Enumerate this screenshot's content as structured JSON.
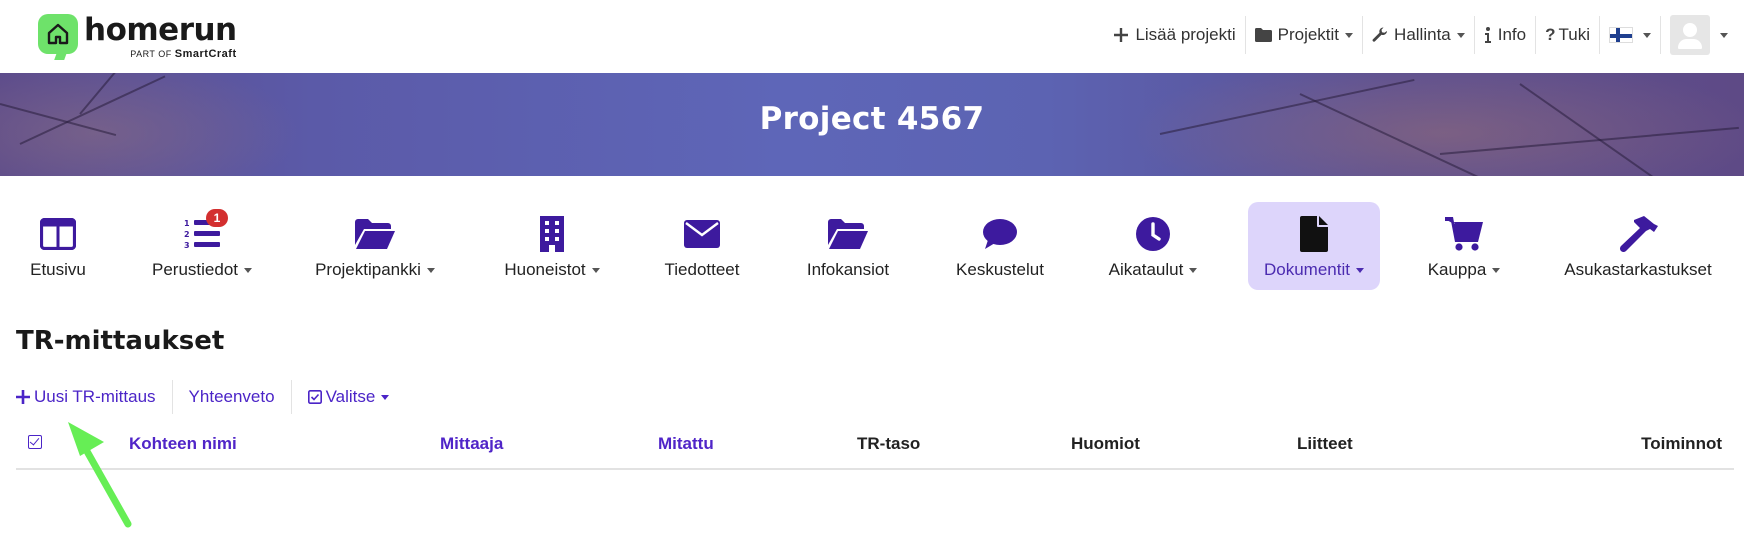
{
  "logo": {
    "word": "homerun",
    "sub_prefix": "PART OF",
    "sub_brand": "SmartCraft"
  },
  "topnav": {
    "add_project": "Lisää projekti",
    "projects": "Projektit",
    "admin": "Hallinta",
    "info": "Info",
    "support": "Tuki",
    "language": "fi"
  },
  "banner": {
    "title": "Project 4567"
  },
  "modules": [
    {
      "label": "Etusivu",
      "icon": "columns-icon",
      "dropdown": false
    },
    {
      "label": "Perustiedot",
      "icon": "ordered-list-icon",
      "dropdown": true,
      "badge": "1"
    },
    {
      "label": "Projektipankki",
      "icon": "folder-open-icon",
      "dropdown": true
    },
    {
      "label": "Huoneistot",
      "icon": "building-icon",
      "dropdown": true
    },
    {
      "label": "Tiedotteet",
      "icon": "envelope-icon",
      "dropdown": false
    },
    {
      "label": "Infokansiot",
      "icon": "folder-open-icon",
      "dropdown": false
    },
    {
      "label": "Keskustelut",
      "icon": "comment-icon",
      "dropdown": false
    },
    {
      "label": "Aikataulut",
      "icon": "clock-icon",
      "dropdown": true
    },
    {
      "label": "Dokumentit",
      "icon": "file-icon",
      "dropdown": true,
      "active": true
    },
    {
      "label": "Kauppa",
      "icon": "cart-icon",
      "dropdown": true
    },
    {
      "label": "Asukastarkastukset",
      "icon": "hammer-icon",
      "dropdown": false
    }
  ],
  "page": {
    "title": "TR-mittaukset",
    "actions": {
      "new": "Uusi TR-mittaus",
      "summary": "Yhteenveto",
      "select": "Valitse"
    }
  },
  "table": {
    "columns": [
      "Kohteen nimi",
      "Mittaaja",
      "Mitattu",
      "TR-taso",
      "Huomiot",
      "Liitteet",
      "Toiminnot"
    ]
  },
  "colors": {
    "accent": "#4b24c7",
    "active_bg": "#ddd5fb",
    "logo_green": "#6ee26a",
    "badge": "#d32f2f",
    "annotation_arrow": "#66ee55"
  }
}
